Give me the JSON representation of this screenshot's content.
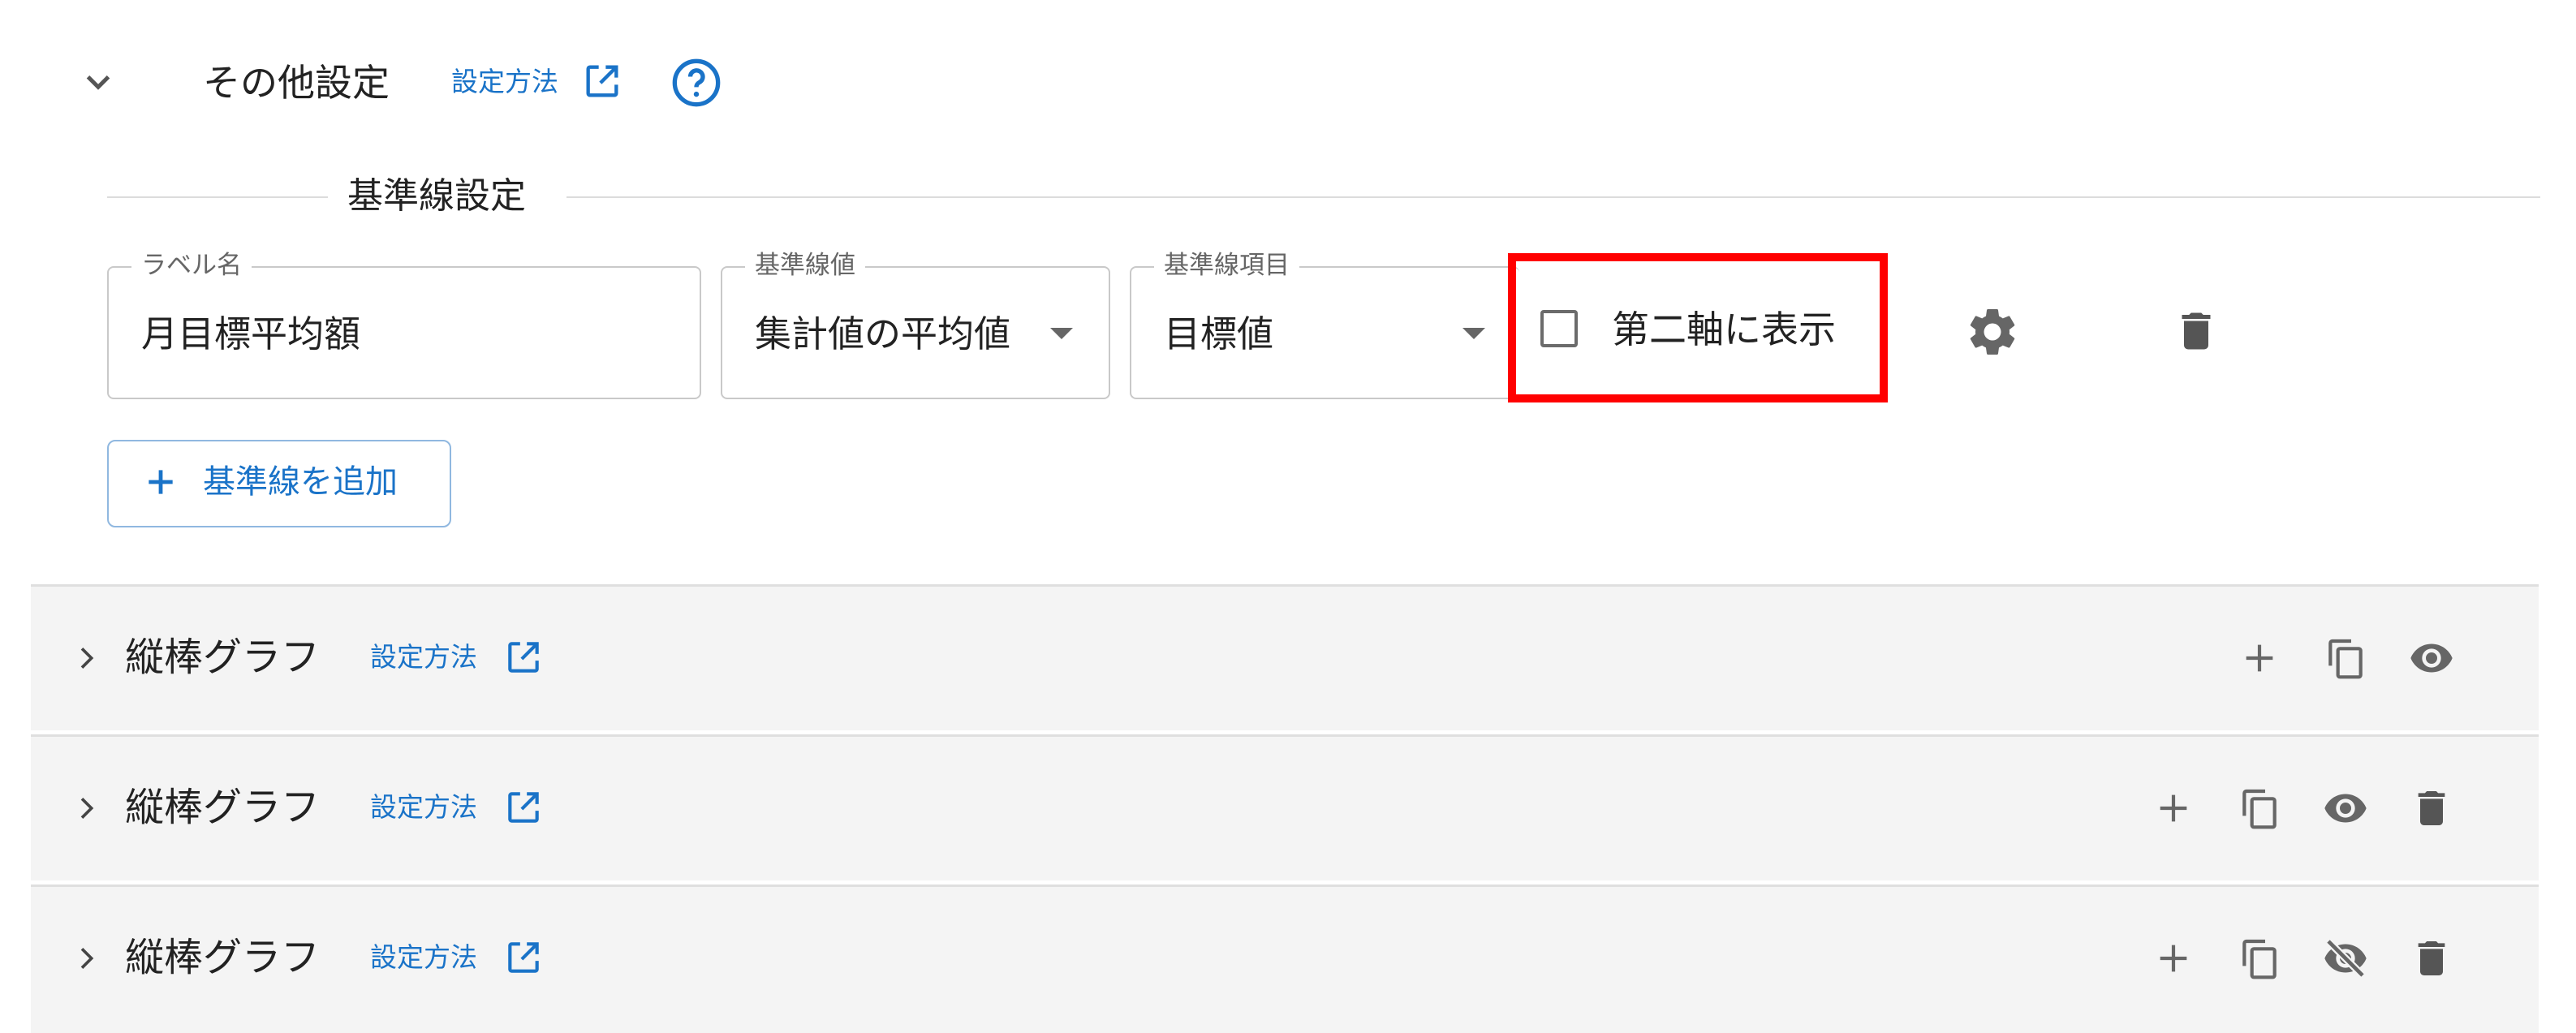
{
  "other_settings": {
    "title": "その他設定",
    "howto_link": "設定方法"
  },
  "baseline": {
    "section_title": "基準線設定",
    "label_field": {
      "legend": "ラベル名",
      "value": "月目標平均額"
    },
    "value_field": {
      "legend": "基準線値",
      "value": "集計値の平均値"
    },
    "item_field": {
      "legend": "基準線項目",
      "value": "目標値"
    },
    "secondary_axis": {
      "label": "第二軸に表示",
      "checked": false
    },
    "add_button": "基準線を追加"
  },
  "series": [
    {
      "title": "縦棒グラフ",
      "howto_link": "設定方法",
      "visible": true,
      "deletable": false
    },
    {
      "title": "縦棒グラフ",
      "howto_link": "設定方法",
      "visible": true,
      "deletable": true
    },
    {
      "title": "縦棒グラフ",
      "howto_link": "設定方法",
      "visible": false,
      "deletable": true
    }
  ],
  "colors": {
    "accent": "#1a73c8",
    "highlight": "#ff0000",
    "row_bg": "#f4f4f4"
  }
}
